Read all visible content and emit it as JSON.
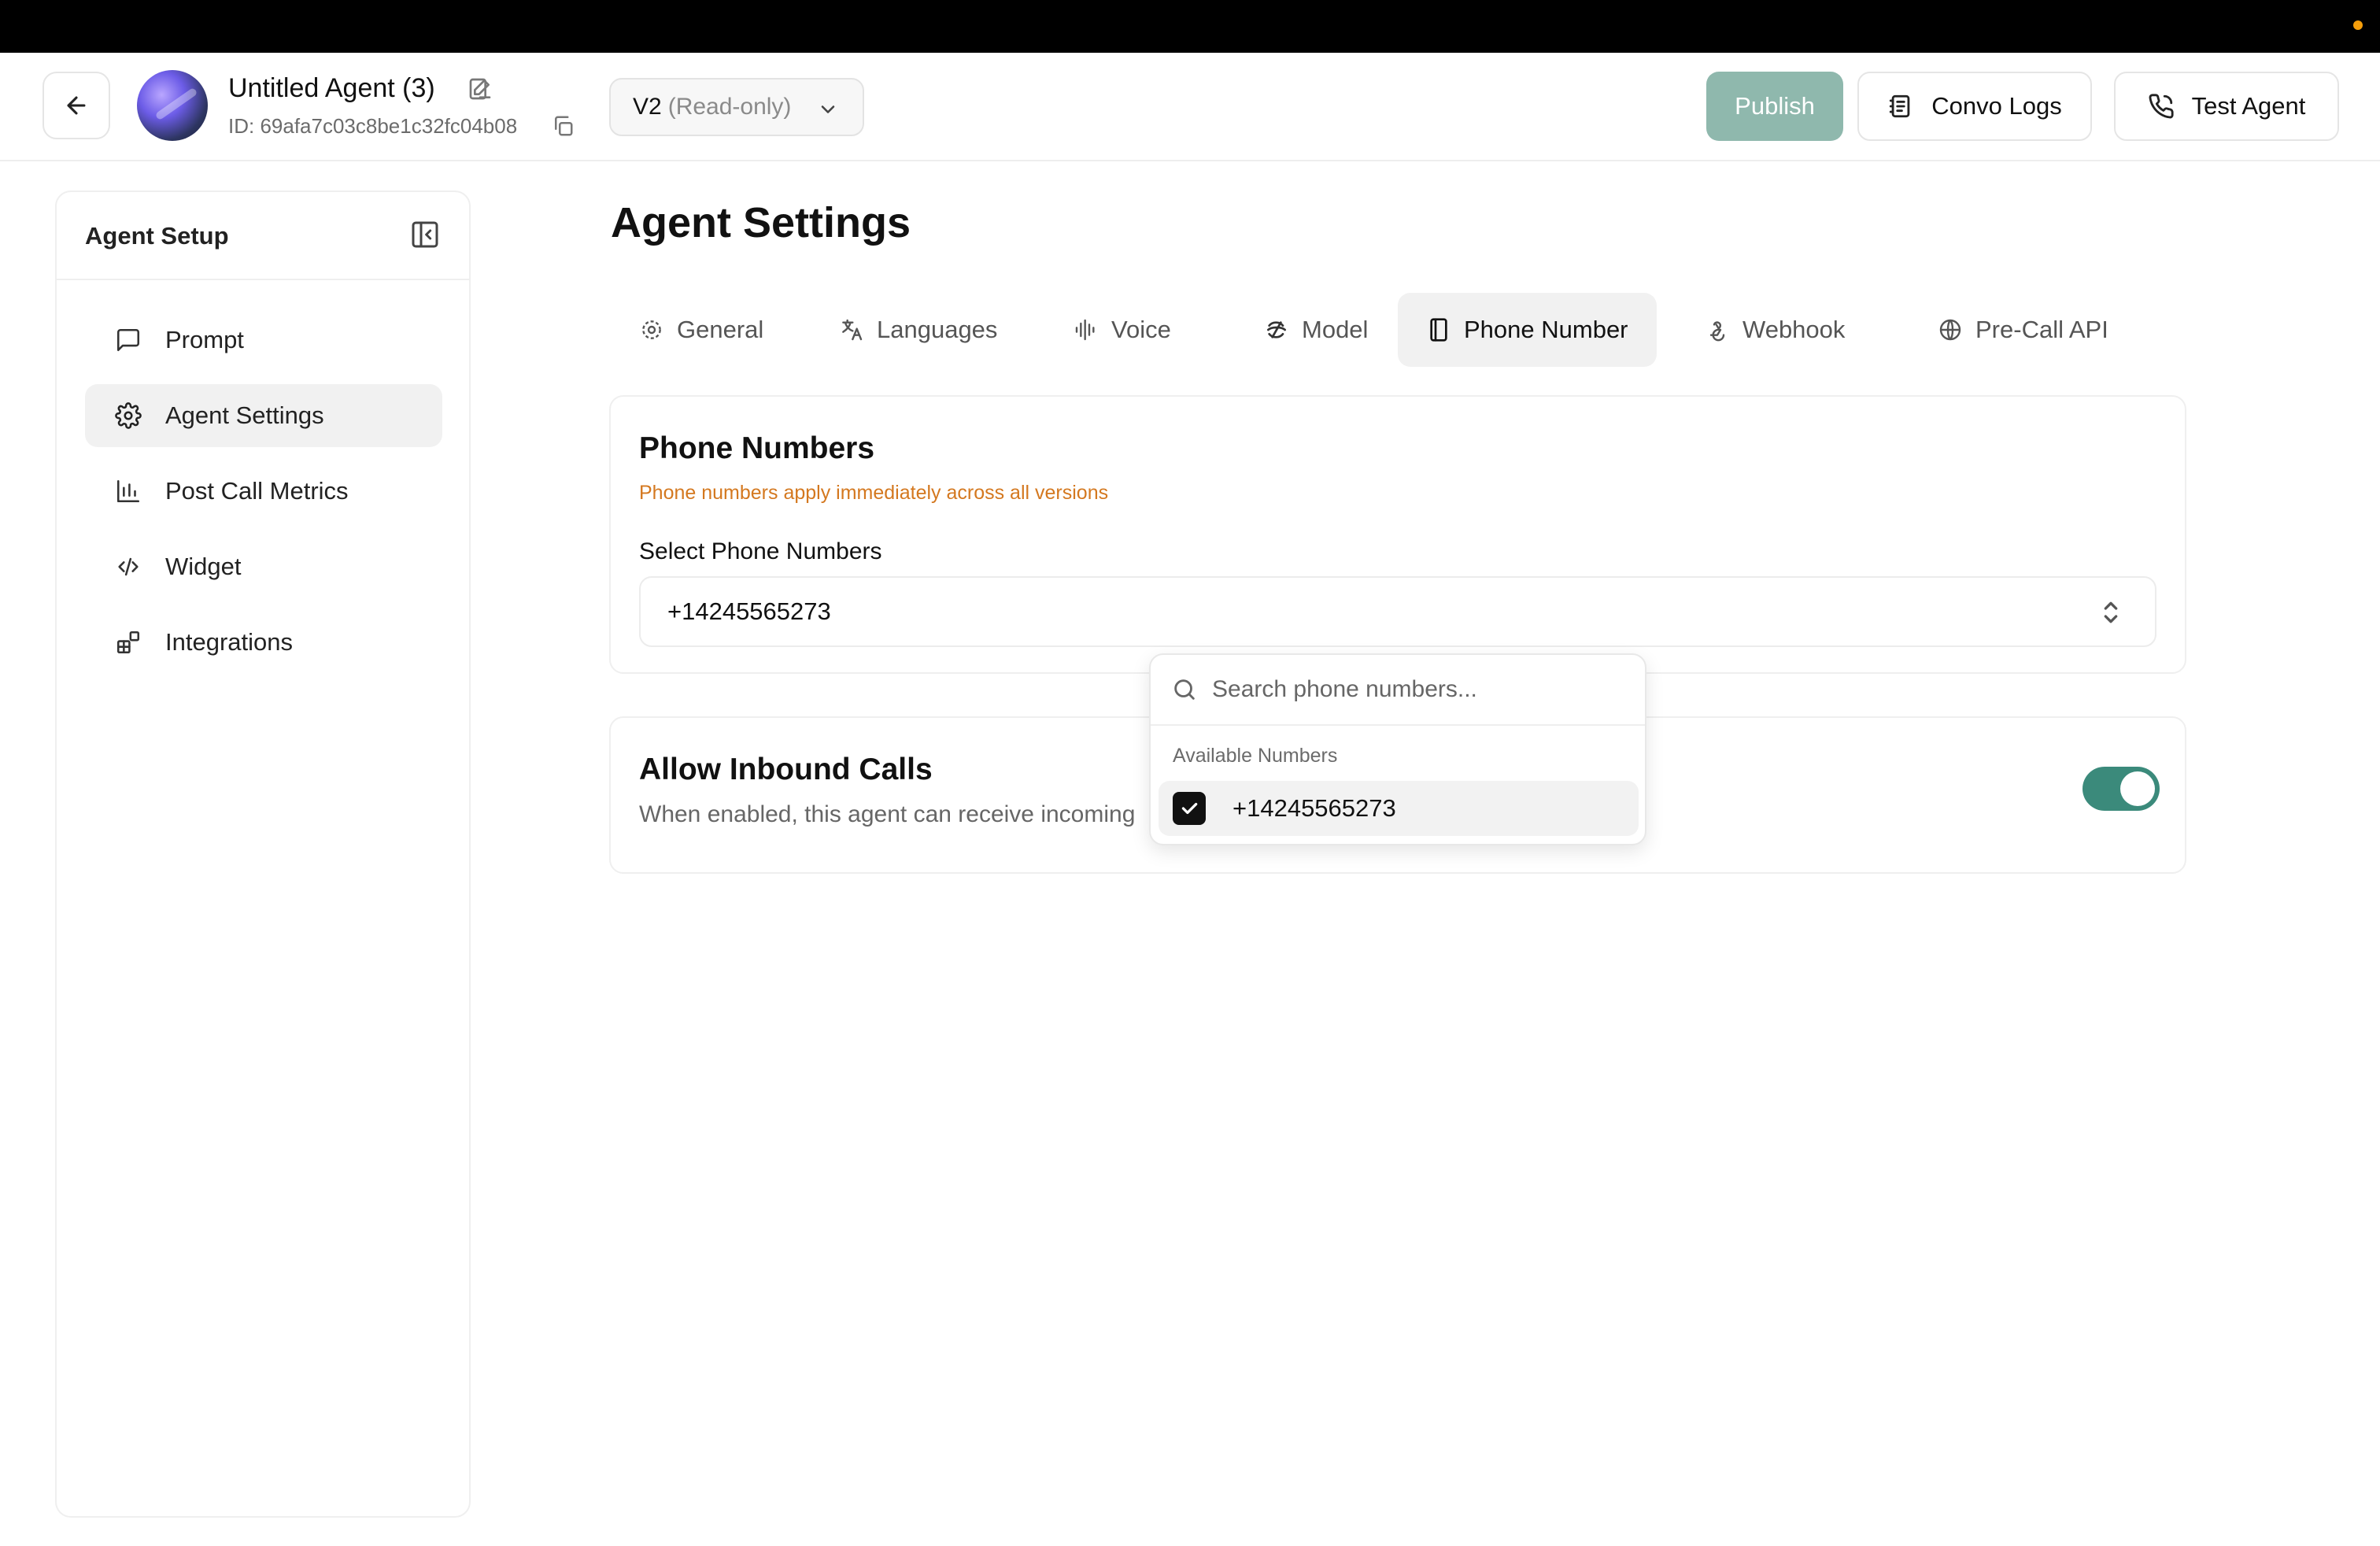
{
  "header": {
    "agent_name": "Untitled Agent (3)",
    "agent_id": "ID: 69afa7c03c8be1c32fc04b08",
    "version_label": "V2",
    "version_state": "(Read-only)",
    "publish_label": "Publish",
    "convo_logs_label": "Convo Logs",
    "test_agent_label": "Test Agent"
  },
  "sidebar": {
    "title": "Agent Setup",
    "items": [
      {
        "label": "Prompt",
        "icon": "message-square-icon",
        "active": false
      },
      {
        "label": "Agent Settings",
        "icon": "gear-icon",
        "active": true
      },
      {
        "label": "Post Call Metrics",
        "icon": "bar-chart-icon",
        "active": false
      },
      {
        "label": "Widget",
        "icon": "code-icon",
        "active": false
      },
      {
        "label": "Integrations",
        "icon": "blocks-icon",
        "active": false
      }
    ]
  },
  "main": {
    "title": "Agent Settings",
    "tabs": [
      {
        "label": "General",
        "icon": "gear-icon"
      },
      {
        "label": "Languages",
        "icon": "translate-icon"
      },
      {
        "label": "Voice",
        "icon": "audio-wave-icon"
      },
      {
        "label": "Model",
        "icon": "model-icon"
      },
      {
        "label": "Phone Number",
        "icon": "phone-book-icon",
        "active": true
      },
      {
        "label": "Webhook",
        "icon": "webhook-icon"
      },
      {
        "label": "Pre-Call API",
        "icon": "globe-icon"
      }
    ],
    "phone_card": {
      "title": "Phone Numbers",
      "note": "Phone numbers apply immediately across all versions",
      "field_label": "Select Phone Numbers",
      "selected_value": "+14245565273"
    },
    "inbound_card": {
      "title": "Allow Inbound Calls",
      "description": "When enabled, this agent can receive incoming",
      "enabled": true
    }
  },
  "dropdown": {
    "search_placeholder": "Search phone numbers...",
    "group_label": "Available Numbers",
    "options": [
      {
        "label": "+14245565273",
        "checked": true
      }
    ]
  },
  "colors": {
    "accent": "#3b8a7b",
    "publish_bg": "#8fb8ad",
    "note_orange": "#d4781f",
    "status_dot": "#f59e0b"
  }
}
